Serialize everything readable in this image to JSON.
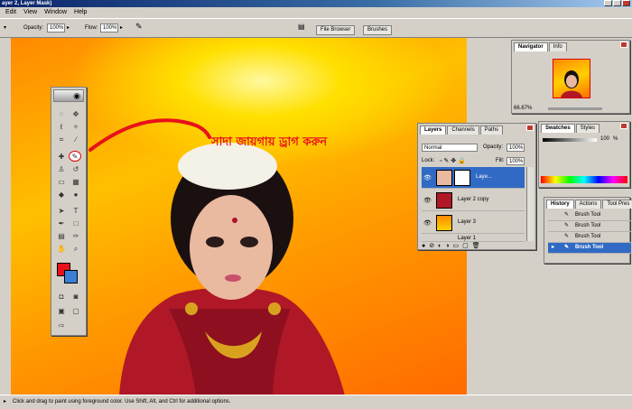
{
  "window": {
    "title": "ayer 2, Layer Mask)"
  },
  "menu": [
    "Edit",
    "View",
    "Window",
    "Help"
  ],
  "options": {
    "opacity_label": "Opacity:",
    "opacity_value": "100%",
    "flow_label": "Flow:",
    "flow_value": "100%",
    "tabs": [
      "File Browser",
      "Brushes"
    ]
  },
  "canvas": {
    "annotation": "সাদা জায়গায় ড্রাগ করুন",
    "colors": {
      "red_stroke": "#e8101a",
      "bg_orange": "#ff8a00",
      "bg_yellow": "#ffe000"
    }
  },
  "navigator": {
    "tabs": [
      "Navigator",
      "Info"
    ],
    "zoom": "66.67%"
  },
  "swatches": {
    "tabs": [
      "Swatches",
      "Styles"
    ],
    "value": "100",
    "unit": "%"
  },
  "layers": {
    "tabs": [
      "Layers",
      "Channels",
      "Paths"
    ],
    "blend_mode": "Normal",
    "opacity_label": "Opacity:",
    "opacity_value": "100%",
    "lock_label": "Lock:",
    "fill_label": "Fill:",
    "fill_value": "100%",
    "items": [
      {
        "name": "Laye...",
        "active": true
      },
      {
        "name": "Layer 2 copy",
        "active": false
      },
      {
        "name": "Layer 3",
        "active": false
      },
      {
        "name": "Layer 1",
        "active": false
      }
    ]
  },
  "history": {
    "tabs": [
      "History",
      "Actions",
      "Tool Pres"
    ],
    "items": [
      {
        "label": "Brush Tool",
        "active": false
      },
      {
        "label": "Brush Tool",
        "active": false
      },
      {
        "label": "Brush Tool",
        "active": false
      },
      {
        "label": "Brush Tool",
        "active": true
      }
    ]
  },
  "status": {
    "text": "Click and drag to paint using foreground color.  Use Shift, Alt, and Ctrl for additional options."
  }
}
